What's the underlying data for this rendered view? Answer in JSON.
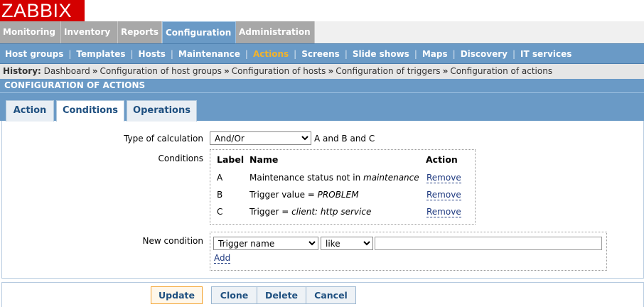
{
  "logo": "ZABBIX",
  "main_menu": [
    "Monitoring",
    "Inventory",
    "Reports",
    "Configuration",
    "Administration"
  ],
  "sub_menu": [
    "Host groups",
    "Templates",
    "Hosts",
    "Maintenance",
    "Actions",
    "Screens",
    "Slide shows",
    "Maps",
    "Discovery",
    "IT services"
  ],
  "history": {
    "label": "History:",
    "crumbs": [
      "Dashboard",
      "Configuration of host groups",
      "Configuration of hosts",
      "Configuration of triggers",
      "Configuration of actions"
    ]
  },
  "section_title": "CONFIGURATION OF ACTIONS",
  "tabs": [
    "Action",
    "Conditions",
    "Operations"
  ],
  "calc": {
    "label": "Type of calculation",
    "selected": "And/Or",
    "expression": "A and B and C"
  },
  "conditions": {
    "label": "Conditions",
    "headers": {
      "label": "Label",
      "name": "Name",
      "action": "Action"
    },
    "rows": [
      {
        "label": "A",
        "text": "Maintenance status not in ",
        "value": "maintenance",
        "remove": "Remove"
      },
      {
        "label": "B",
        "text": "Trigger value = ",
        "value": "PROBLEM",
        "remove": "Remove"
      },
      {
        "label": "C",
        "text": "Trigger = ",
        "value": "client: http service",
        "remove": "Remove"
      }
    ]
  },
  "new_condition": {
    "label": "New condition",
    "type_selected": "Trigger name",
    "operator_selected": "like",
    "value": "",
    "add": "Add"
  },
  "buttons": {
    "update": "Update",
    "clone": "Clone",
    "delete": "Delete",
    "cancel": "Cancel"
  },
  "colors": {
    "logo_red": "#d40000",
    "menu_blue": "#6a9ac6",
    "active_orange": "#f3b32a",
    "menu_grey": "#a8a8a8"
  }
}
